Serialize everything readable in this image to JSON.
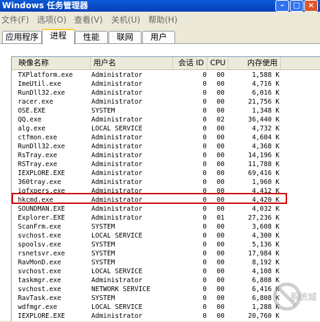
{
  "window": {
    "title": "Windows 任务管理器",
    "controls": {
      "min": "–",
      "max": "□",
      "close": "×"
    }
  },
  "menu": {
    "items": [
      "文件(F)",
      "选项(O)",
      "查看(V)",
      "关机(U)",
      "帮助(H)"
    ]
  },
  "tabs": [
    {
      "label": "应用程序",
      "active": false
    },
    {
      "label": "进程",
      "active": true
    },
    {
      "label": "性能",
      "active": false
    },
    {
      "label": "联网",
      "active": false
    },
    {
      "label": "用户",
      "active": false
    }
  ],
  "table": {
    "columns": [
      "映像名称",
      "用户名",
      "会话 ID",
      "CPU",
      "内存使用"
    ],
    "rows": [
      [
        "TXPlatform.exe",
        "Administrator",
        "0",
        "00",
        "1,588 K"
      ],
      [
        "ImeUtil.exe",
        "Administrator",
        "0",
        "00",
        "4,716 K"
      ],
      [
        "RunDll32.exe",
        "Administrator",
        "0",
        "00",
        "6,016 K"
      ],
      [
        "racer.exe",
        "Administrator",
        "0",
        "00",
        "21,756 K"
      ],
      [
        "OSE.EXE",
        "SYSTEM",
        "0",
        "00",
        "1,348 K"
      ],
      [
        "QQ.exe",
        "Administrator",
        "0",
        "02",
        "36,440 K"
      ],
      [
        "alg.exe",
        "LOCAL SERVICE",
        "0",
        "00",
        "4,732 K"
      ],
      [
        "ctfmon.exe",
        "Administrator",
        "0",
        "00",
        "4,604 K"
      ],
      [
        "RunDll32.exe",
        "Administrator",
        "0",
        "00",
        "4,368 K"
      ],
      [
        "RsTray.exe",
        "Administrator",
        "0",
        "00",
        "14,196 K"
      ],
      [
        "RSTray.exe",
        "Administrator",
        "0",
        "00",
        "11,788 K"
      ],
      [
        "IEXPLORE.EXE",
        "Administrator",
        "0",
        "00",
        "69,416 K"
      ],
      [
        "360tray.exe",
        "Administrator",
        "0",
        "00",
        "1,960 K"
      ],
      [
        "igfxpers.exe",
        "Administrator",
        "0",
        "00",
        "4,412 K"
      ],
      [
        "hkcmd.exe",
        "Administrator",
        "0",
        "00",
        "4,420 K"
      ],
      [
        "SOUNDMAN.EXE",
        "Administrator",
        "0",
        "00",
        "4,032 K"
      ],
      [
        "Explorer.EXE",
        "Administrator",
        "0",
        "01",
        "27,236 K"
      ],
      [
        "ScanFrm.exe",
        "SYSTEM",
        "0",
        "00",
        "3,608 K"
      ],
      [
        "svchost.exe",
        "LOCAL SERVICE",
        "0",
        "00",
        "4,300 K"
      ],
      [
        "spoolsv.exe",
        "SYSTEM",
        "0",
        "00",
        "5,136 K"
      ],
      [
        "rsnetsvr.exe",
        "SYSTEM",
        "0",
        "00",
        "17,984 K"
      ],
      [
        "RavMonD.exe",
        "SYSTEM",
        "0",
        "00",
        "8,192 K"
      ],
      [
        "svchost.exe",
        "LOCAL SERVICE",
        "0",
        "00",
        "4,108 K"
      ],
      [
        "taskmgr.exe",
        "Administrator",
        "0",
        "00",
        "6,808 K"
      ],
      [
        "svchost.exe",
        "NETWORK SERVICE",
        "0",
        "00",
        "6,416 K"
      ],
      [
        "RavTask.exe",
        "SYSTEM",
        "0",
        "00",
        "6,808 K"
      ],
      [
        "wdfmgr.exe",
        "LOCAL SERVICE",
        "0",
        "00",
        "1,288 K"
      ],
      [
        "IEXPLORE.EXE",
        "Administrator",
        "0",
        "00",
        "20,760 K"
      ]
    ],
    "highlighted_row": 14
  },
  "watermark": {
    "text": "系统城"
  }
}
